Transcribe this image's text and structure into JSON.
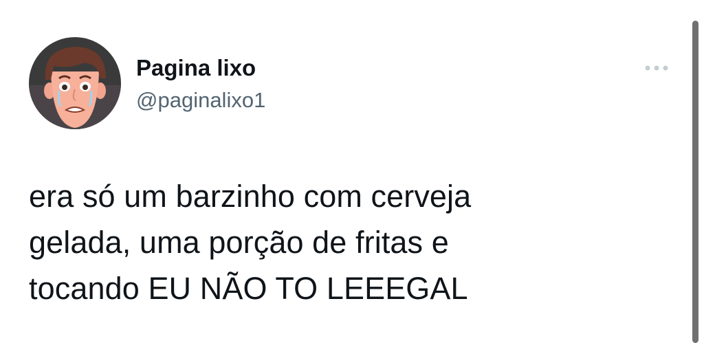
{
  "tweet": {
    "author": {
      "display_name": "Pagina lixo",
      "handle": "@paginalixo1",
      "avatar_icon": "crying-cartoon-face-avatar"
    },
    "more_icon": "more-horizontal-icon",
    "text": "era só um barzinho com cerveja\ngelada, uma porção de fritas e\ntocando EU NÃO TO LEEEGAL"
  },
  "colors": {
    "text_primary": "#0f1419",
    "text_secondary": "#536471",
    "background": "#ffffff",
    "scrollbar": "#707070"
  }
}
